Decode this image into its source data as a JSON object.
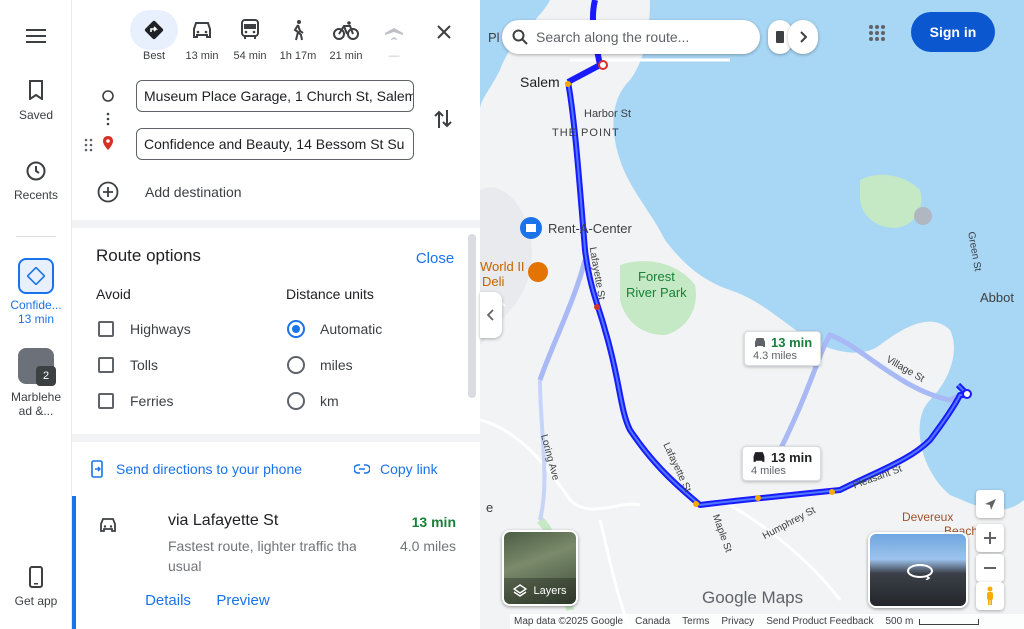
{
  "rail": {
    "saved": "Saved",
    "recents": "Recents",
    "recent_item1": [
      "Confide...",
      "13 min"
    ],
    "recent_item2": [
      "Marblehe",
      "ad &..."
    ],
    "get_app": "Get app"
  },
  "modes": [
    {
      "label": "Best",
      "icon": "directions-icon"
    },
    {
      "label": "13 min",
      "icon": "car-icon"
    },
    {
      "label": "54 min",
      "icon": "transit-icon"
    },
    {
      "label": "1h 17m",
      "icon": "walk-icon"
    },
    {
      "label": "21 min",
      "icon": "bike-icon"
    },
    {
      "label": "—",
      "icon": "flight-icon"
    }
  ],
  "waypoints": {
    "origin": "Museum Place Garage, 1 Church St, Salem",
    "destination": "Confidence and Beauty, 14 Bessom St Su"
  },
  "add_destination": "Add destination",
  "route_options": {
    "title": "Route options",
    "close": "Close",
    "avoid_label": "Avoid",
    "avoid": [
      "Highways",
      "Tolls",
      "Ferries"
    ],
    "units_label": "Distance units",
    "units": [
      "Automatic",
      "miles",
      "km"
    ],
    "selected_unit": "Automatic"
  },
  "actions": {
    "send": "Send directions to your phone",
    "copy": "Copy link"
  },
  "route": {
    "title": "via Lafayette St",
    "time": "13 min",
    "subtitle": "Fastest route, lighter traffic than",
    "subtitle2": "usual",
    "distance": "4.0 miles",
    "details": "Details",
    "preview": "Preview"
  },
  "map": {
    "search_placeholder": "Search along the route...",
    "sign_in": "Sign in",
    "layers": "Layers",
    "callout1": {
      "time": "13 min",
      "dist": "4.3 miles"
    },
    "callout2": {
      "time": "13 min",
      "dist": "4 miles"
    },
    "labels": {
      "salem": "Salem",
      "harbor": "Harbor St",
      "point": "THE POINT",
      "rentacenter": "Rent-A-Center",
      "forest": [
        "Forest",
        "River Park"
      ],
      "world": "World II",
      "deli": "Deli",
      "lafayette": "Lafayette St",
      "village": "Village St",
      "pleasant": "Pleasant St",
      "humphrey": "Humphrey St",
      "maple": "Maple St",
      "loring": "Loring Ave",
      "devereux": "Devereux",
      "beach": "Beach",
      "abbot": "Abbot",
      "green": "Green St",
      "pl": "Pl",
      "e": "e",
      "google": "Google Maps"
    },
    "footer": [
      "Map data ©2025 Google",
      "Canada",
      "Terms",
      "Privacy",
      "Send Product Feedback",
      "500 m"
    ]
  },
  "colors": {
    "accent": "#1a73e8",
    "route": "#1a1aff",
    "alt_route": "#a8b9f5",
    "water": "#a8d6f5",
    "land": "#f1f3f4",
    "park": "#c5e8c5",
    "time_green": "#188038"
  }
}
